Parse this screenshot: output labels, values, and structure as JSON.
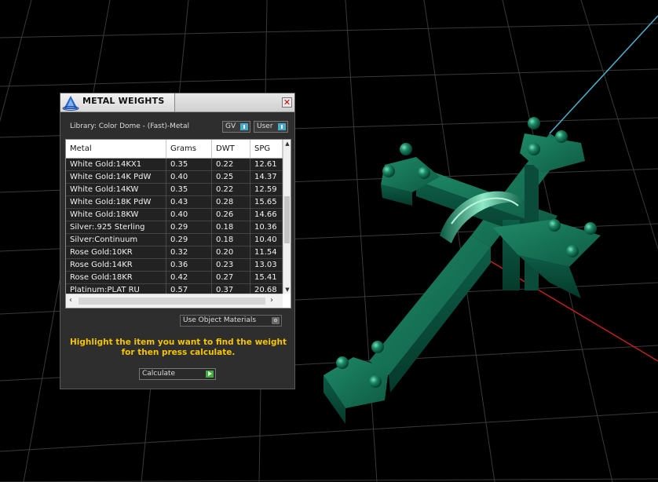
{
  "panel": {
    "title": "METAL WEIGHTS",
    "close_glyph": "✕",
    "library_label": "Library: Color Dome - (Fast)-Metal",
    "gv_toggle_label": "GV",
    "user_toggle_label": "User"
  },
  "table": {
    "columns": [
      "Metal",
      "Grams",
      "DWT",
      "SPG"
    ],
    "rows": [
      [
        "White Gold:14KX1",
        "0.35",
        "0.22",
        "12.61"
      ],
      [
        "White Gold:14K PdW",
        "0.40",
        "0.25",
        "14.37"
      ],
      [
        "White Gold:14KW",
        "0.35",
        "0.22",
        "12.59"
      ],
      [
        "White Gold:18K PdW",
        "0.43",
        "0.28",
        "15.65"
      ],
      [
        "White Gold:18KW",
        "0.40",
        "0.26",
        "14.66"
      ],
      [
        "Silver:.925 Sterling",
        "0.29",
        "0.18",
        "10.36"
      ],
      [
        "Silver:Continuum",
        "0.29",
        "0.18",
        "10.40"
      ],
      [
        "Rose Gold:10KR",
        "0.32",
        "0.20",
        "11.54"
      ],
      [
        "Rose Gold:14KR",
        "0.36",
        "0.23",
        "13.03"
      ],
      [
        "Rose Gold:18KR",
        "0.42",
        "0.27",
        "15.41"
      ],
      [
        "Platinum:PLAT RU",
        "0.57",
        "0.37",
        "20.68"
      ]
    ],
    "scroll_up": "▲",
    "scroll_down": "▼",
    "scroll_left": "‹",
    "scroll_right": "›"
  },
  "use_materials_label": "Use Object Materials",
  "instruction": "Highlight the item you want to find the weight for then press calculate.",
  "calculate_label": "Calculate",
  "colors": {
    "accent_yellow": "#f5c400",
    "toggle_blue": "#4aa8c8",
    "calculate_green": "#3fae3f",
    "model_green": "#1a7a5a",
    "background": "#000000"
  },
  "icons": {
    "title": "app-logo-icon",
    "close": "close-icon",
    "calculate": "play-arrow-icon"
  }
}
